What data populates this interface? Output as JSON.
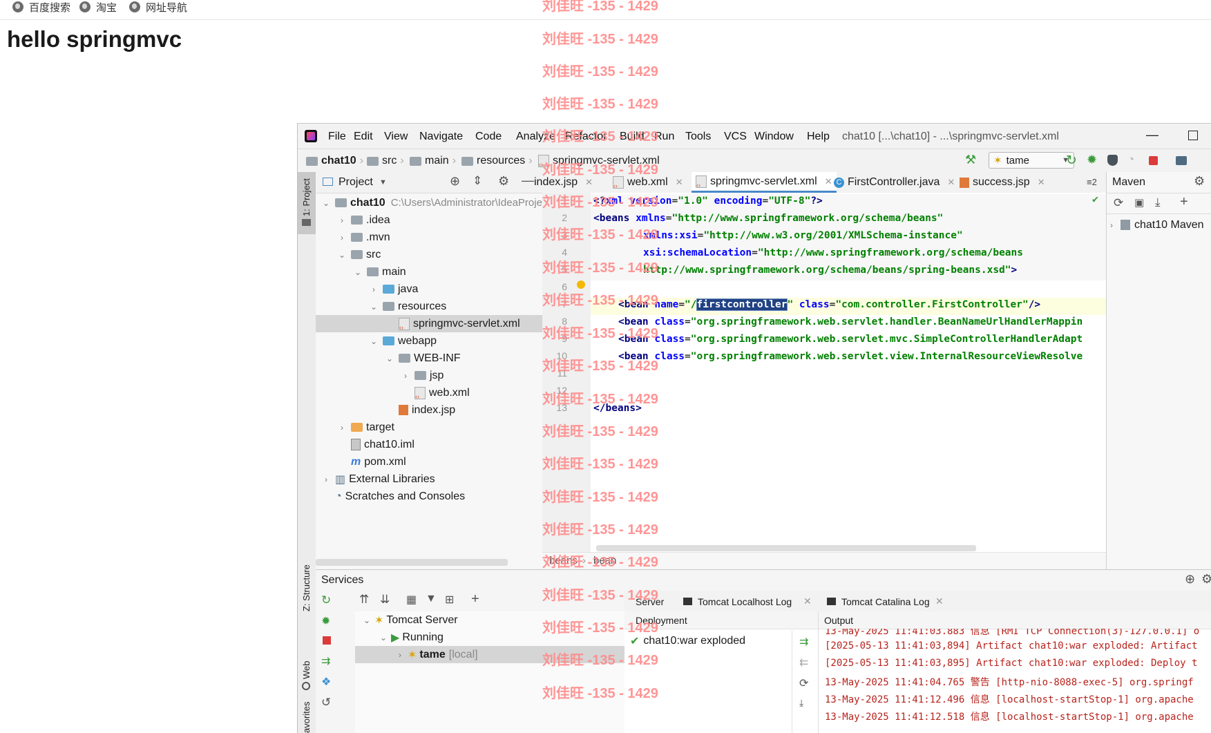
{
  "browser": {
    "bookmarks": [
      "百度搜索",
      "淘宝",
      "网址导航"
    ],
    "heading": "hello springmvc"
  },
  "watermark": "刘佳旺 -135 - 1429",
  "ide": {
    "menu": [
      "File",
      "Edit",
      "View",
      "Navigate",
      "Code",
      "Analyze",
      "Refactor",
      "Build",
      "Run",
      "Tools",
      "VCS",
      "Window",
      "Help"
    ],
    "window_title": "chat10 [...\\chat10] - ...\\springmvc-servlet.xml",
    "breadcrumbs": [
      "chat10",
      "src",
      "main",
      "resources",
      "springmvc-servlet.xml"
    ],
    "run_config": "tame",
    "project_panel_title": "Project",
    "tree": [
      {
        "label": "chat10",
        "path": "C:\\Users\\Administrator\\IdeaProje",
        "depth": 0,
        "expanded": true
      },
      {
        "label": ".idea",
        "depth": 1,
        "expanded": false
      },
      {
        "label": ".mvn",
        "depth": 1,
        "expanded": false
      },
      {
        "label": "src",
        "depth": 1,
        "expanded": true
      },
      {
        "label": "main",
        "depth": 2,
        "expanded": true
      },
      {
        "label": "java",
        "depth": 3,
        "expanded": false
      },
      {
        "label": "resources",
        "depth": 3,
        "expanded": true
      },
      {
        "label": "springmvc-servlet.xml",
        "depth": 4,
        "selected": true
      },
      {
        "label": "webapp",
        "depth": 3,
        "expanded": true
      },
      {
        "label": "WEB-INF",
        "depth": 4,
        "expanded": true
      },
      {
        "label": "jsp",
        "depth": 5,
        "expanded": false
      },
      {
        "label": "web.xml",
        "depth": 5
      },
      {
        "label": "index.jsp",
        "depth": 4
      },
      {
        "label": "target",
        "depth": 1,
        "expanded": false
      },
      {
        "label": "chat10.iml",
        "depth": 1
      },
      {
        "label": "pom.xml",
        "depth": 1
      },
      {
        "label": "External Libraries",
        "depth": 0,
        "expanded": false
      },
      {
        "label": "Scratches and Consoles",
        "depth": 0
      }
    ],
    "tabs": [
      {
        "label": "index.jsp"
      },
      {
        "label": "web.xml"
      },
      {
        "label": "springmvc-servlet.xml",
        "active": true
      },
      {
        "label": "FirstController.java"
      },
      {
        "label": "success.jsp"
      }
    ],
    "tab_overflow": "≡2",
    "line_numbers": [
      "1",
      "2",
      "3",
      "4",
      "5",
      "6",
      "7",
      "8",
      "9",
      "10",
      "11",
      "12",
      "13"
    ],
    "editor_breadcrumb": [
      "beans",
      "bean"
    ],
    "maven": {
      "title": "Maven",
      "item": "chat10 Maven"
    },
    "left_strip": [
      "1: Project",
      "Z: Structure",
      "Web",
      "avorites"
    ],
    "services": {
      "title": "Services",
      "tree": [
        {
          "label": "Tomcat Server"
        },
        {
          "label": "Running"
        },
        {
          "label": "tame",
          "suffix": "[local]"
        }
      ],
      "tabs": [
        "Server",
        "Tomcat Localhost Log",
        "Tomcat Catalina Log"
      ],
      "deployment_label": "Deployment",
      "output_label": "Output",
      "deployment_item": "chat10:war exploded",
      "log": [
        "13-May-2025 11:41:03.883 信息 [RMI TCP Connection(3)-127.0.0.1] o",
        "[2025-05-13 11:41:03,894] Artifact chat10:war exploded: Artifact",
        "[2025-05-13 11:41:03,895] Artifact chat10:war exploded: Deploy t",
        "13-May-2025 11:41:04.765 警告 [http-nio-8088-exec-5] org.springf",
        "13-May-2025 11:41:12.496 信息 [localhost-startStop-1] org.apache",
        "13-May-2025 11:41:12.518 信息 [localhost-startStop-1] org.apache"
      ]
    }
  },
  "code": {
    "l1": {
      "a": "<?",
      "b": "xml ",
      "c": "version",
      "d": "=",
      "e": "\"1.0\"",
      "f": " encoding",
      "g": "=",
      "h": "\"UTF-8\"",
      "i": "?>"
    },
    "l2": {
      "a": "<beans ",
      "b": "xmlns",
      "c": "=",
      "d": "\"http://www.springframework.org/schema/beans\""
    },
    "l3": {
      "a": "xmlns:xsi",
      "b": "=",
      "c": "\"http://www.w3.org/2001/XMLSchema-instance\""
    },
    "l4": {
      "a": "xsi:schemaLocation",
      "b": "=",
      "c": "\"http://www.springframework.org/schema/beans"
    },
    "l5": {
      "a": "http://www.springframework.org/schema/beans/spring-beans.xsd\"",
      "b": ">"
    },
    "l7": {
      "a": "<bean ",
      "b": "name",
      "c": "=",
      "d": "\"/",
      "e": "firstcontroller",
      "f": "\"",
      "g": " class",
      "h": "=",
      "i": "\"com.controller.FirstController\"",
      "j": "/>"
    },
    "l8": {
      "a": "<bean ",
      "b": "class",
      "c": "=",
      "d": "\"org.springframework.web.servlet.handler.BeanNameUrlHandlerMappin"
    },
    "l9": {
      "a": "<bean ",
      "b": "class",
      "c": "=",
      "d": "\"org.springframework.web.servlet.mvc.SimpleControllerHandlerAdapt"
    },
    "l10": {
      "a": "<bean ",
      "b": "class",
      "c": "=",
      "d": "\"org.springframework.web.servlet.view.InternalResourceViewResolve"
    },
    "l13": {
      "a": "</beans>"
    }
  }
}
